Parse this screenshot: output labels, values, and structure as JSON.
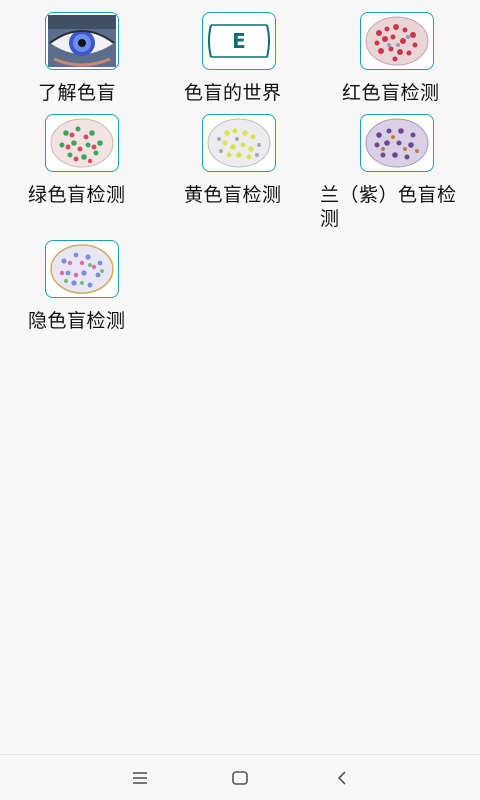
{
  "items": [
    {
      "label": "了解色盲",
      "icon": "eye-icon"
    },
    {
      "label": "色盲的世界",
      "icon": "tumbling-e-chart-icon"
    },
    {
      "label": "红色盲检测",
      "icon": "red-ishihara-plate-icon"
    },
    {
      "label": "绿色盲检测",
      "icon": "green-ishihara-plate-icon"
    },
    {
      "label": "黄色盲检测",
      "icon": "yellow-ishihara-plate-icon"
    },
    {
      "label_line1": "兰（紫）色盲检",
      "label_line2": "测",
      "icon": "purple-ishihara-plate-icon"
    },
    {
      "label": "隐色盲检测",
      "icon": "hidden-ishihara-plate-icon"
    }
  ],
  "e_chart_letter": "E",
  "navbar": {
    "menu_icon": "menu-icon",
    "home_icon": "home-icon",
    "back_icon": "back-icon"
  },
  "colors": {
    "accent": "#1aa3b8",
    "background": "#f7f7f7"
  }
}
